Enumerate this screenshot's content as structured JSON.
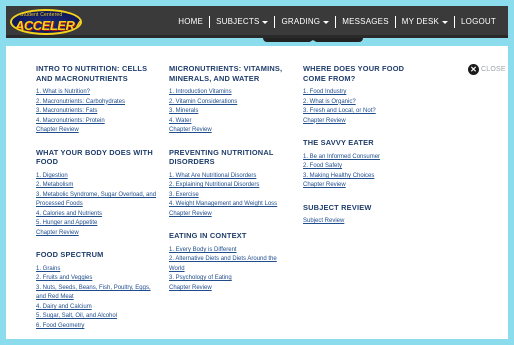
{
  "logo": {
    "tagline": "Student Centered",
    "name": "ACCELERATE"
  },
  "nav": {
    "home": "HOME",
    "subjects": "SUBJECTS",
    "grading": "GRADING",
    "messages": "MESSAGES",
    "my_desk": "MY DESK",
    "logout": "LOGOUT"
  },
  "close_label": "CLOSE",
  "columns": [
    {
      "sections": [
        {
          "title": "INTRO TO NUTRITION: CELLS AND MACRONUTRIENTS",
          "items": [
            "1. What is Nutrition?",
            "2. Macronutrients: Carbohydrates",
            "3. Macronutrients: Fats",
            "4. Macronutrients: Protein"
          ],
          "review": "Chapter Review"
        },
        {
          "title": "WHAT YOUR BODY DOES WITH FOOD",
          "items": [
            "1. Digestion",
            "2. Metabolism",
            "3. Metabolic Syndrome, Sugar Overload, and Processed Foods",
            "4. Calories and Nutrients",
            "5. Hunger and Appetite"
          ],
          "review": "Chapter Review"
        },
        {
          "title": "FOOD SPECTRUM",
          "items": [
            "1. Grains",
            "2. Fruits and Veggies",
            "3. Nuts, Seeds, Beans, Fish, Poultry, Eggs, and Red Meat",
            "4. Dairy and Calcium",
            "5. Sugar, Salt, Oil, and Alcohol",
            "6. Food Geometry"
          ],
          "review": ""
        }
      ]
    },
    {
      "sections": [
        {
          "title": "MICRONUTRIENTS: VITAMINS, MINERALS, AND WATER",
          "items": [
            "1. Introduction Vitamins",
            "2. Vitamin Considerations",
            "3. Minerals",
            "4. Water"
          ],
          "review": "Chapter Review"
        },
        {
          "title": "PREVENTING NUTRITIONAL DISORDERS",
          "items": [
            "1. What Are Nutritional Disorders",
            "2. Explaining Nutritional Disorders",
            "3. Exercise",
            "4. Weight Management and Weight Loss"
          ],
          "review": "Chapter Review"
        },
        {
          "title": "EATING IN CONTEXT",
          "items": [
            "1. Every Body is Different",
            "2. Alternative Diets and Diets Around the World",
            "3. Psychology of Eating"
          ],
          "review": "Chapter Review"
        }
      ]
    },
    {
      "sections": [
        {
          "title": "WHERE DOES YOUR FOOD COME FROM?",
          "items": [
            "1. Food Industry",
            "2. What is Organic?",
            "3. Fresh and Local, or Not?"
          ],
          "review": "Chapter Review"
        },
        {
          "title": "THE SAVVY EATER",
          "items": [
            "1. Be an Informed Consumer",
            "2. Food Safety",
            "3. Making Healthy Choices"
          ],
          "review": "Chapter Review"
        },
        {
          "title": "SUBJECT REVIEW",
          "items": [],
          "review": "Subject Review"
        }
      ]
    }
  ]
}
